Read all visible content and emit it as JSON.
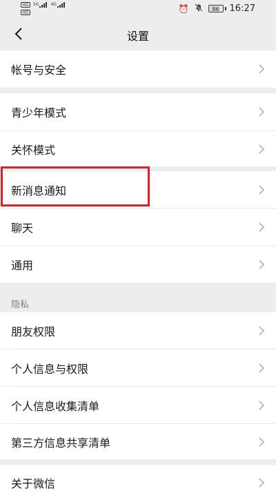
{
  "status_bar": {
    "sim1_badge": "HD",
    "sim2_badge": "HD",
    "sim1_network": "5G",
    "sim2_network": "4G",
    "battery": "86",
    "time": "16:27",
    "icons": [
      "alarm-icon",
      "mute-icon",
      "battery-icon"
    ]
  },
  "header": {
    "title": "设置",
    "back_icon": "chevron-left-icon"
  },
  "groups": [
    {
      "items": [
        {
          "label": "帐号与安全"
        }
      ]
    },
    {
      "items": [
        {
          "label": "青少年模式"
        },
        {
          "label": "关怀模式"
        }
      ]
    },
    {
      "items": [
        {
          "label": "新消息通知"
        },
        {
          "label": "聊天"
        },
        {
          "label": "通用"
        }
      ]
    },
    {
      "header": "隐私",
      "items": [
        {
          "label": "朋友权限"
        },
        {
          "label": "个人信息与权限"
        },
        {
          "label": "个人信息收集清单"
        },
        {
          "label": "第三方信息共享清单"
        }
      ]
    },
    {
      "items": [
        {
          "label": "关于微信"
        }
      ]
    }
  ],
  "highlight": {
    "target": "新消息通知",
    "color": "#e02028"
  },
  "colors": {
    "background": "#ededed",
    "row_background": "#ffffff",
    "text": "#191919",
    "section_header": "#808080",
    "chevron": "#b2b2b2"
  }
}
